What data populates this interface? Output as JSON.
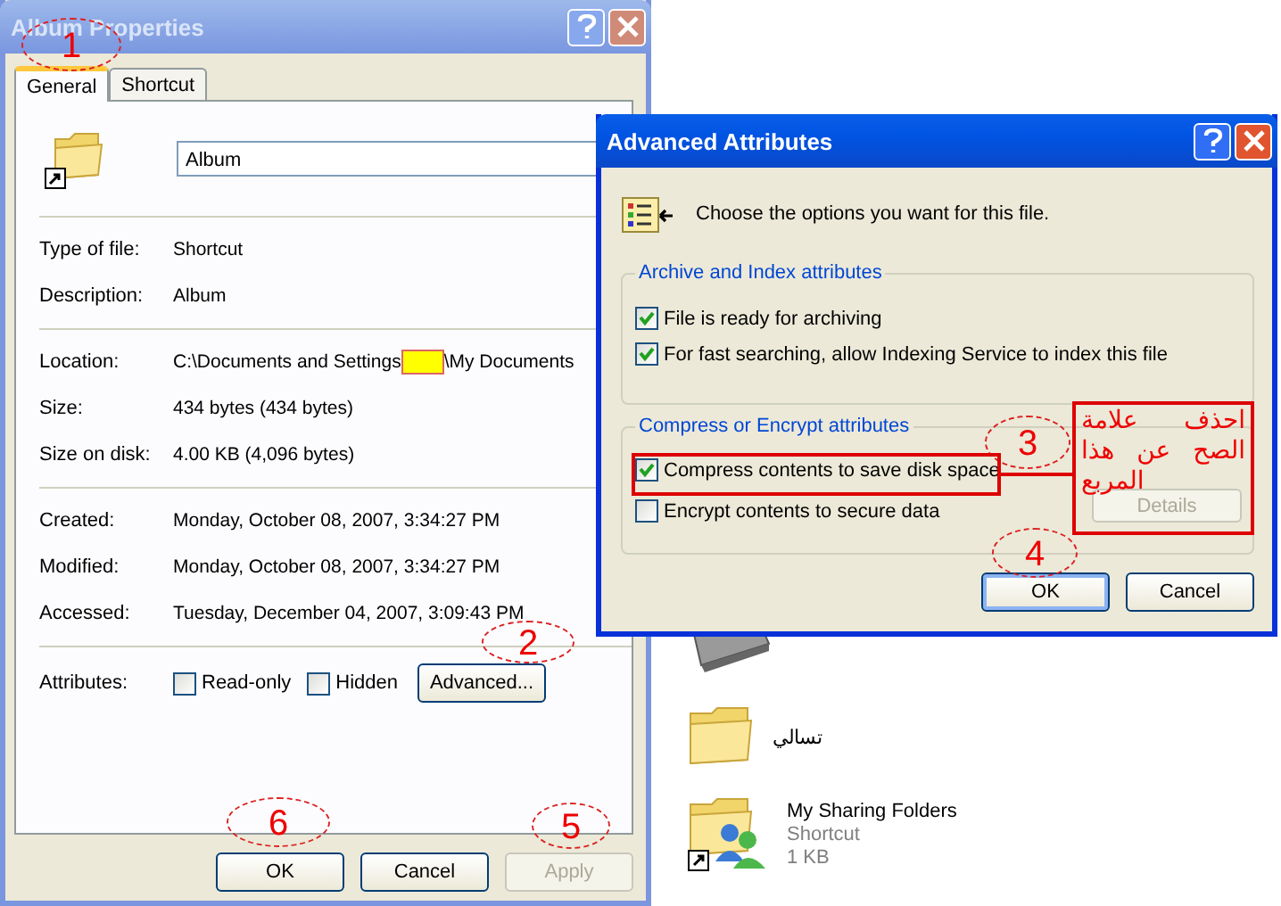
{
  "explorer": {
    "items": [
      {
        "kind": "drive"
      },
      {
        "kind": "folder",
        "name": "تسالي"
      },
      {
        "kind": "shared-shortcut",
        "name": "My Sharing Folders",
        "type": "Shortcut",
        "size": "1 KB"
      }
    ]
  },
  "properties": {
    "title": "Album Properties",
    "tabs": [
      {
        "label": "General",
        "selected": true
      },
      {
        "label": "Shortcut",
        "selected": false
      }
    ],
    "name_value": "Album",
    "sections": [
      [
        {
          "label": "Type of file:",
          "value": "Shortcut"
        },
        {
          "label": "Description:",
          "value": "Album"
        }
      ],
      [
        {
          "label": "Location:",
          "value": "C:\\Documents and Settings",
          "redacted": true,
          "value_after": "\\My Documents"
        },
        {
          "label": "Size:",
          "value": "434 bytes (434 bytes)"
        },
        {
          "label": "Size on disk:",
          "value": "4.00 KB (4,096 bytes)"
        }
      ],
      [
        {
          "label": "Created:",
          "value": "Monday, October 08, 2007, 3:34:27 PM"
        },
        {
          "label": "Modified:",
          "value": "Monday, October 08, 2007, 3:34:27 PM"
        },
        {
          "label": "Accessed:",
          "value": "Tuesday, December 04, 2007, 3:09:43 PM"
        }
      ]
    ],
    "attributes_label": "Attributes:",
    "attributes": [
      {
        "label": "Read-only",
        "checked": false
      },
      {
        "label": "Hidden",
        "checked": false
      }
    ],
    "advanced_button": "Advanced...",
    "buttons": [
      {
        "label": "OK",
        "disabled": false
      },
      {
        "label": "Cancel",
        "disabled": false
      },
      {
        "label": "Apply",
        "disabled": true
      }
    ]
  },
  "advanced": {
    "title": "Advanced Attributes",
    "intro": "Choose the options you want for this file.",
    "groups": [
      {
        "title": "Archive and Index attributes",
        "options": [
          {
            "label": "File is ready for archiving",
            "checked": true
          },
          {
            "label": "For fast searching, allow Indexing Service to index this file",
            "checked": true
          }
        ]
      },
      {
        "title": "Compress or Encrypt attributes",
        "options": [
          {
            "label": "Compress contents to save disk space",
            "checked": true
          },
          {
            "label": "Encrypt contents to secure data",
            "checked": false
          }
        ]
      }
    ],
    "details_button": {
      "label": "Details",
      "disabled": true
    },
    "buttons": [
      {
        "label": "OK",
        "disabled": false
      },
      {
        "label": "Cancel",
        "disabled": false
      }
    ]
  },
  "annotations": {
    "numbers": [
      "1",
      "2",
      "3",
      "4",
      "5",
      "6"
    ],
    "note": "احذف علامة الصح عن هذا المربع"
  }
}
